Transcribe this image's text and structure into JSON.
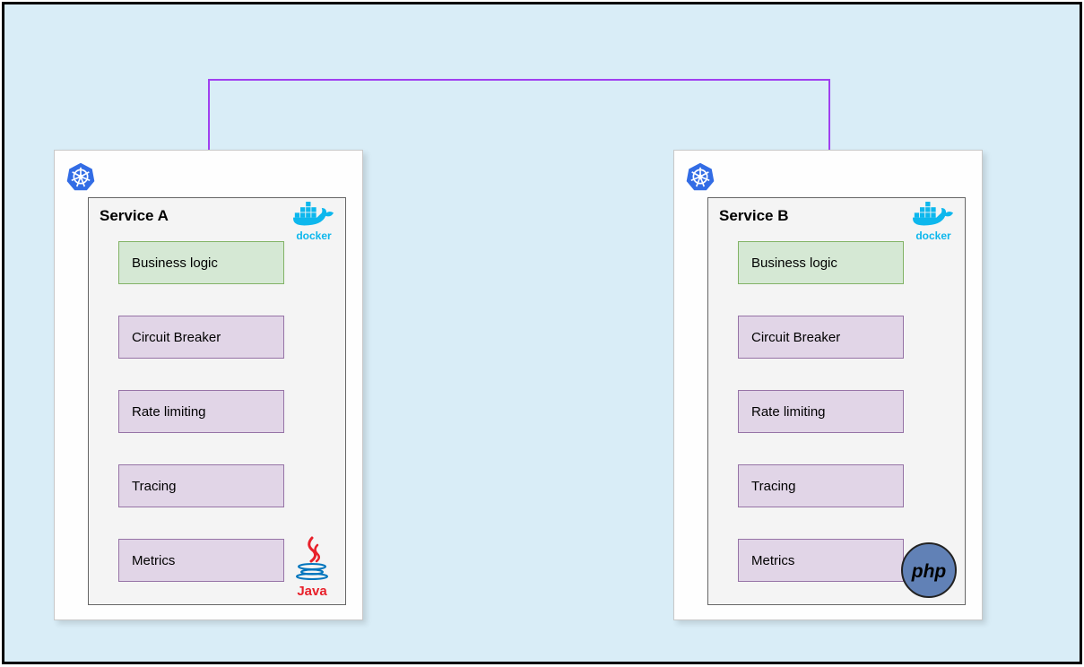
{
  "services": {
    "a": {
      "title": "Service A",
      "boxes": [
        "Business logic",
        "Circuit Breaker",
        "Rate limiting",
        "Tracing",
        "Metrics"
      ],
      "lang": "Java"
    },
    "b": {
      "title": "Service B",
      "boxes": [
        "Business logic",
        "Circuit Breaker",
        "Rate limiting",
        "Tracing",
        "Metrics"
      ],
      "lang": "php"
    }
  },
  "icons": {
    "docker_label": "docker"
  },
  "colors": {
    "bg": "#d9edf7",
    "green_fill": "#d5e8d4",
    "green_border": "#82b366",
    "purple_fill": "#e1d5e7",
    "purple_border": "#9673a6",
    "arrow": "#a040f0",
    "k8s": "#326ce5",
    "docker": "#0db7ed",
    "java": "#e8202a",
    "php_bg": "#6181b6"
  }
}
